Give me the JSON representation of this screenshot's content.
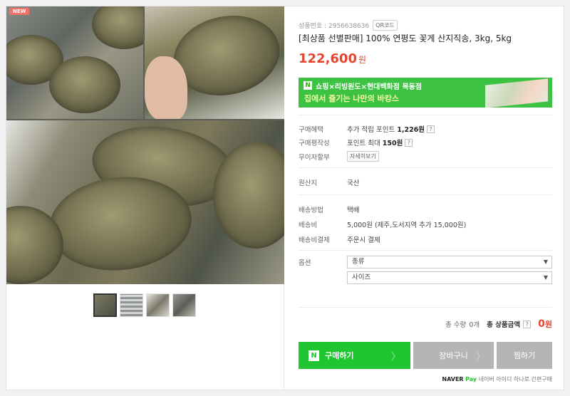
{
  "gallery": {
    "badge": "NEW",
    "thumbnails": [
      "thumb-1",
      "thumb-2",
      "thumb-3",
      "thumb-4"
    ]
  },
  "product": {
    "number_label": "상품번호 : 2956638636",
    "qr_label": "QR코드",
    "title": "[최상품 선별판매] 100% 연평도 꽃게 산지직송, 3kg, 5kg",
    "price": "122,600",
    "currency": "원"
  },
  "banner": {
    "logo": "N",
    "line1": "쇼핑×리빙원도×현대백화점 목동점",
    "line2": "집에서 즐기는 나만의 바캉스"
  },
  "benefits": {
    "purchase_label": "구매혜택",
    "purchase_value_prefix": "추가 적립 포인트",
    "purchase_value": "1,226원",
    "review_label": "구매평작성",
    "review_value_prefix": "포인트 최대",
    "review_value": "150원",
    "installment_label": "무이자할부",
    "installment_button": "자세히보기",
    "help": "?"
  },
  "origin": {
    "label": "원산지",
    "value": "국산"
  },
  "shipping": {
    "method_label": "배송방법",
    "method_value": "택배",
    "fee_label": "배송비",
    "fee_value": "5,000원 (제주,도서지역 추가 15,000원)",
    "payment_label": "배송비결제",
    "payment_value": "주문시 결제"
  },
  "options": {
    "label": "옵션",
    "select1": "종류",
    "select2": "사이즈"
  },
  "total": {
    "qty_label": "총 수량",
    "qty_value": "0개",
    "amount_label": "총 상품금액",
    "amount_value": "0",
    "amount_unit": "원"
  },
  "buttons": {
    "buy_logo": "N",
    "buy": "구매하기",
    "cart": "장바구니",
    "wish": "찜하기"
  },
  "npay": {
    "brand": "NAVER",
    "pay": "Pay",
    "text": "네이버 아이디 하나로 간편구매"
  }
}
